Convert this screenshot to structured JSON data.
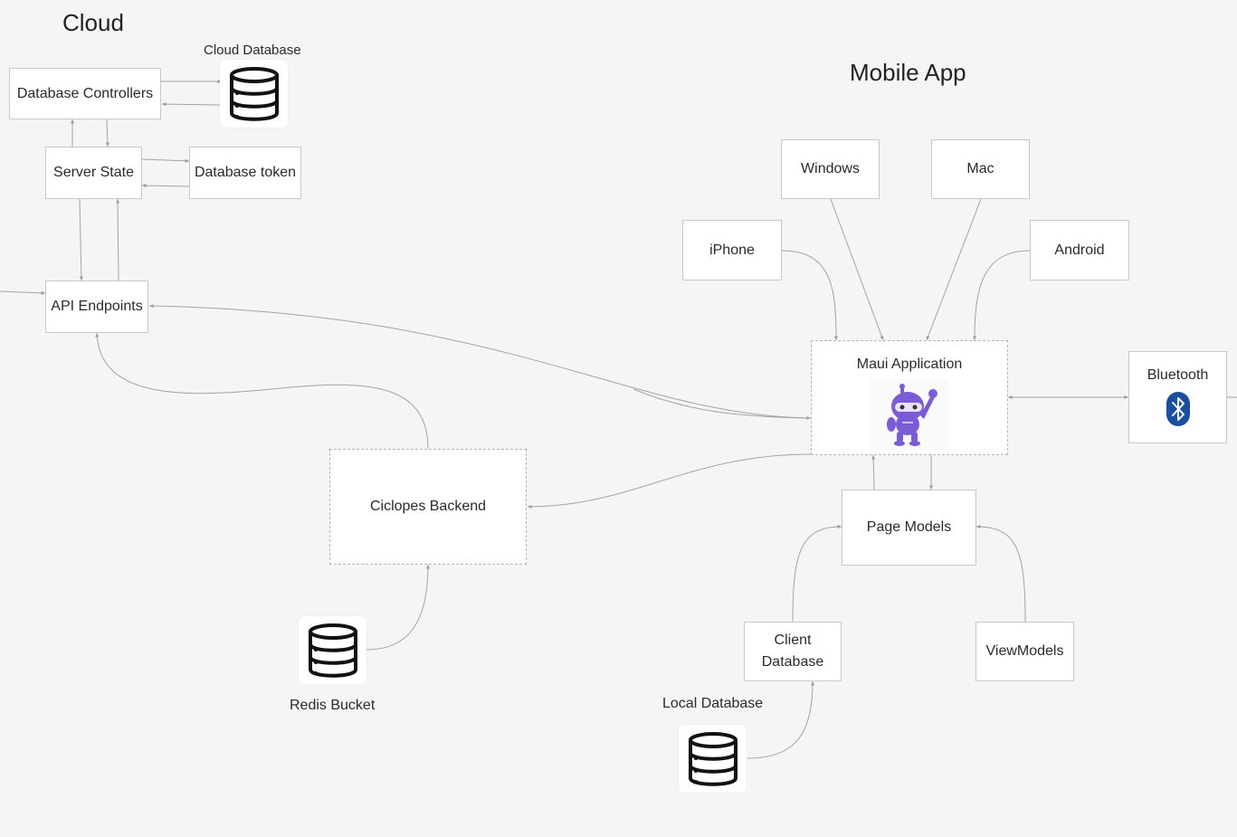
{
  "sections": {
    "cloud": "Cloud",
    "mobile_app": "Mobile App"
  },
  "nodes": {
    "database_controllers": "Database Controllers",
    "server_state": "Server State",
    "database_token": "Database token",
    "api_endpoints": "API Endpoints",
    "ciclopes_backend": "Ciclopes Backend",
    "windows": "Windows",
    "mac": "Mac",
    "iphone": "iPhone",
    "android": "Android",
    "maui_application": "Maui Application",
    "bluetooth": "Bluetooth",
    "page_models": "Page Models",
    "client_database_line1": "Client",
    "client_database_line2": "Database",
    "viewmodels": "ViewModels"
  },
  "captions": {
    "cloud_database": "Cloud Database",
    "redis_bucket": "Redis Bucket",
    "local_database": "Local Database"
  },
  "icons": {
    "database": "database-icon",
    "maui_mascot": "dotnet-bot-icon",
    "bluetooth": "bluetooth-icon"
  },
  "colors": {
    "background": "#f5f5f5",
    "connector": "#9a9a9a",
    "mascot": "#7b5bd6",
    "bluetooth": "#1a4fa0"
  }
}
